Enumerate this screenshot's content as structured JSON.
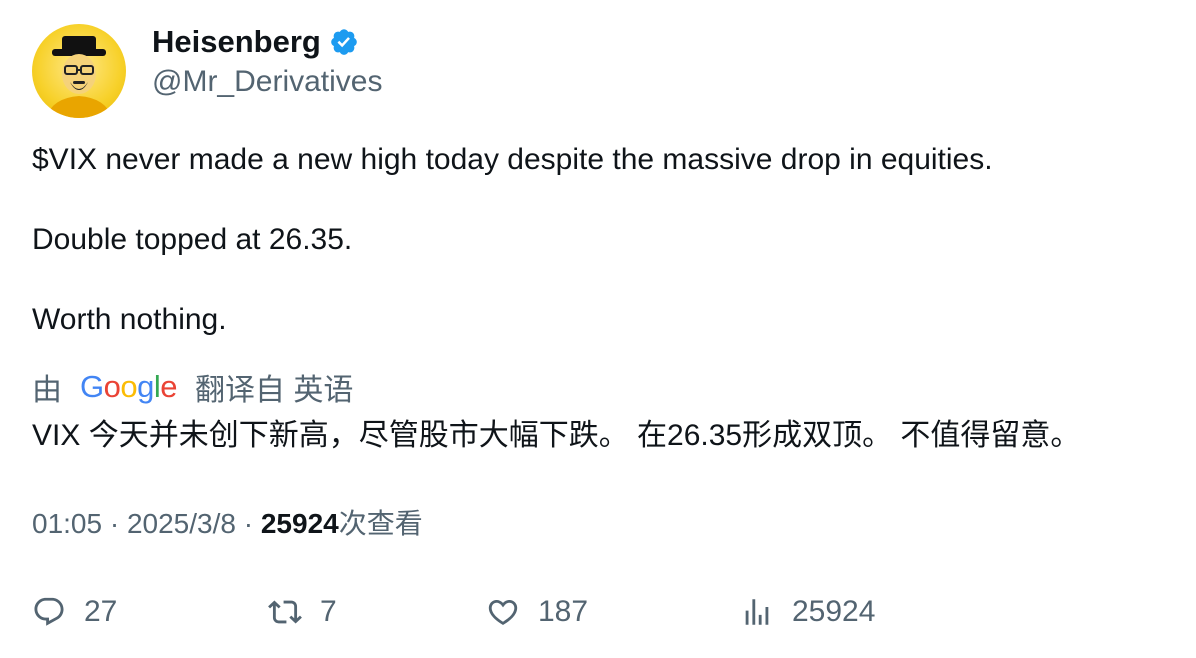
{
  "author": {
    "display_name": "Heisenberg",
    "handle": "@Mr_Derivatives",
    "verified": true,
    "verified_color": "#1d9bf0",
    "avatar_icon": "heisenberg-avatar"
  },
  "tweet": {
    "paragraphs": [
      "$VIX never made a new high today despite the massive drop in equities.",
      "Double topped at 26.35.",
      "Worth nothing."
    ]
  },
  "translation": {
    "prefix": "由",
    "provider": "Google",
    "label": "翻译自 英语",
    "text": "VIX 今天并未创下新高，尽管股市大幅下跌。 在26.35形成双顶。 不值得留意。"
  },
  "meta": {
    "time": "01:05",
    "separator1": " · ",
    "date": "2025/3/8",
    "separator2": " · ",
    "views_count": "25924",
    "views_label": "次查看"
  },
  "actions": {
    "reply": {
      "icon": "reply-icon",
      "count": "27"
    },
    "retweet": {
      "icon": "retweet-icon",
      "count": "7"
    },
    "like": {
      "icon": "heart-icon",
      "count": "187"
    },
    "views": {
      "icon": "analytics-icon",
      "count": "25924"
    }
  },
  "colors": {
    "text": "#0f1419",
    "secondary": "#536471",
    "google_blue": "#4285F4",
    "google_red": "#EA4335",
    "google_yellow": "#FBBC05",
    "google_green": "#34A853"
  }
}
